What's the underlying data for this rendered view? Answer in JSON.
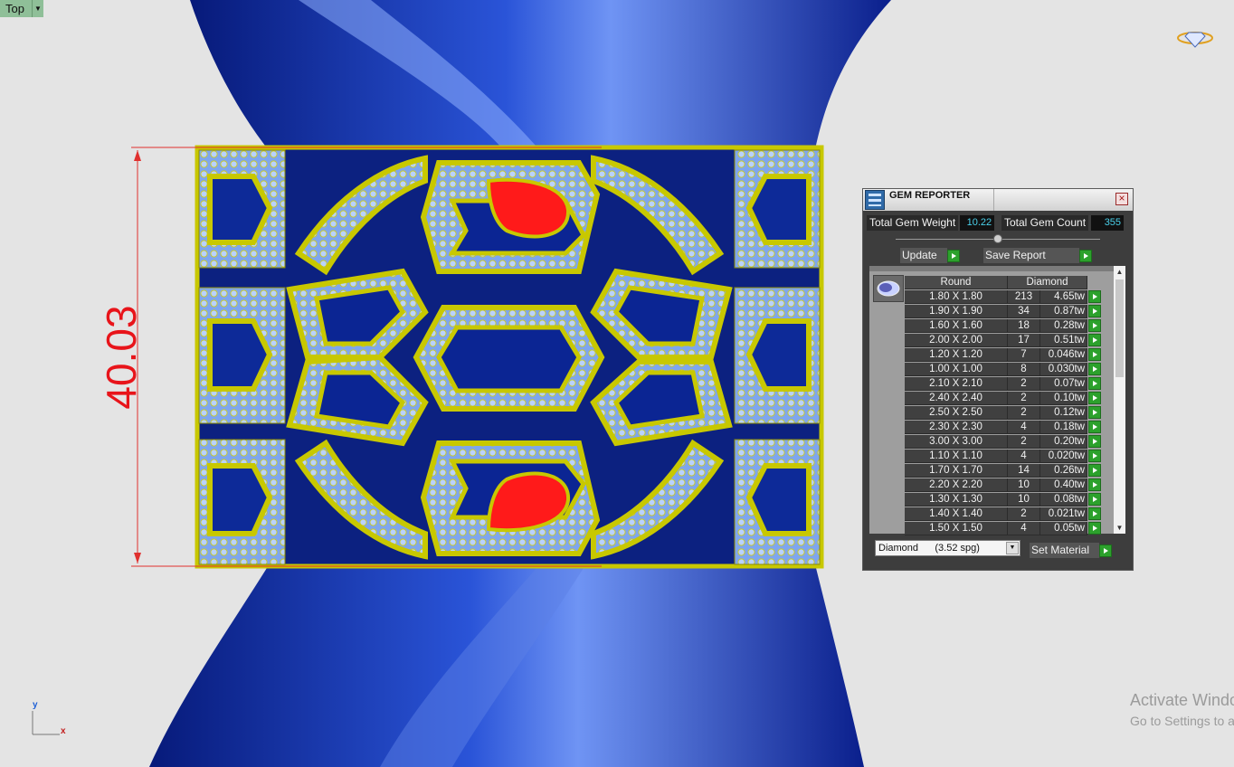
{
  "viewport": {
    "view_name": "Top",
    "dimension_label": "40.03",
    "axis_y": "y",
    "axis_x": "x"
  },
  "watermark": {
    "line1": "Activate Windows",
    "line2": "Go to Settings to activate Windows."
  },
  "gem_reporter": {
    "title": "GEM REPORTER",
    "close_label": "×",
    "total_weight_label": "Total Gem Weight",
    "total_weight_value": "10.22",
    "total_count_label": "Total Gem Count",
    "total_count_value": "355",
    "update_label": "Update",
    "save_report_label": "Save Report",
    "table": {
      "col_shape": "Round",
      "col_material": "Diamond",
      "rows": [
        {
          "size": "1.80 X 1.80",
          "count": "213",
          "weight": "4.65tw"
        },
        {
          "size": "1.90 X 1.90",
          "count": "34",
          "weight": "0.87tw"
        },
        {
          "size": "1.60 X 1.60",
          "count": "18",
          "weight": "0.28tw"
        },
        {
          "size": "2.00 X 2.00",
          "count": "17",
          "weight": "0.51tw"
        },
        {
          "size": "1.20 X 1.20",
          "count": "7",
          "weight": "0.046tw"
        },
        {
          "size": "1.00 X 1.00",
          "count": "8",
          "weight": "0.030tw"
        },
        {
          "size": "2.10 X 2.10",
          "count": "2",
          "weight": "0.07tw"
        },
        {
          "size": "2.40 X 2.40",
          "count": "2",
          "weight": "0.10tw"
        },
        {
          "size": "2.50 X 2.50",
          "count": "2",
          "weight": "0.12tw"
        },
        {
          "size": "2.30 X 2.30",
          "count": "4",
          "weight": "0.18tw"
        },
        {
          "size": "3.00 X 3.00",
          "count": "2",
          "weight": "0.20tw"
        },
        {
          "size": "1.10 X 1.10",
          "count": "4",
          "weight": "0.020tw"
        },
        {
          "size": "1.70 X 1.70",
          "count": "14",
          "weight": "0.26tw"
        },
        {
          "size": "2.20 X 2.20",
          "count": "10",
          "weight": "0.40tw"
        },
        {
          "size": "1.30 X 1.30",
          "count": "10",
          "weight": "0.08tw"
        },
        {
          "size": "1.40 X 1.40",
          "count": "2",
          "weight": "0.021tw"
        },
        {
          "size": "1.50 X 1.50",
          "count": "4",
          "weight": "0.05tw"
        }
      ]
    },
    "material_value": "Diamond      (3.52 spg)",
    "set_material_label": "Set Material"
  },
  "colors": {
    "metal": "#c8c800",
    "gem_blue": "#8ab4f0",
    "ruby": "#ff1a1a",
    "background_shape": "#1f3fb8",
    "panel_bg": "#3d3d3d",
    "green_button": "#2ca12c"
  }
}
